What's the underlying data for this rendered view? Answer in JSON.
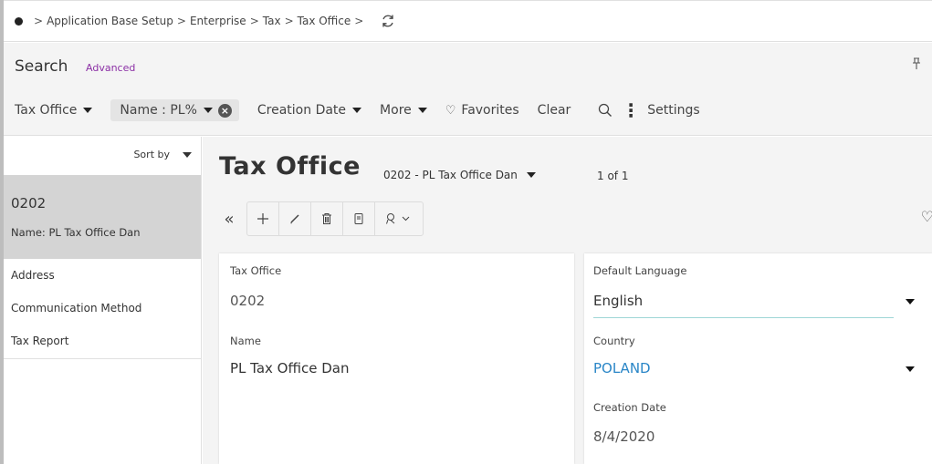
{
  "breadcrumb": {
    "items": [
      "Application Base Setup",
      "Enterprise",
      "Tax",
      "Tax Office"
    ],
    "separator": ">"
  },
  "search": {
    "title": "Search",
    "advanced_label": "Advanced",
    "pin_icon": "pin-icon"
  },
  "filters": {
    "tax_office": "Tax Office",
    "name_chip": "Name : PL%",
    "creation_date": "Creation Date",
    "more": "More",
    "favorites": "Favorites",
    "clear": "Clear",
    "settings": "Settings"
  },
  "left_nav": {
    "sort_by": "Sort by",
    "record": {
      "code": "0202",
      "name_label": "Name:",
      "name_value": "PL Tax Office Dan"
    },
    "items": [
      {
        "label": "Address"
      },
      {
        "label": "Communication Method"
      },
      {
        "label": "Tax Report"
      }
    ]
  },
  "main": {
    "title": "Tax Office",
    "record_selector": "0202 - PL Tax Office Dan",
    "record_count": "1 of 1",
    "toolbar": [
      "collapse-icon",
      "add-icon",
      "edit-icon",
      "delete-icon",
      "duplicate-icon",
      "custom-command-icon"
    ]
  },
  "form": {
    "tax_office": {
      "label": "Tax Office",
      "value": "0202"
    },
    "name": {
      "label": "Name",
      "value": "PL Tax Office Dan"
    },
    "default_language": {
      "label": "Default Language",
      "value": "English"
    },
    "country": {
      "label": "Country",
      "value": "POLAND"
    },
    "creation_date": {
      "label": "Creation Date",
      "value": "8/4/2020"
    }
  },
  "colors": {
    "accent_purple": "#8b2fa5",
    "link_blue": "#2a86c7",
    "selected_row": "#d4d4d4",
    "underline_teal": "#9fd6d6"
  }
}
